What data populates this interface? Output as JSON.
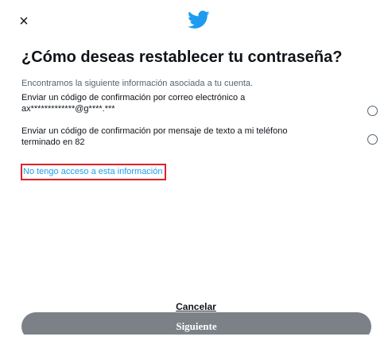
{
  "header": {
    "close_icon": "×",
    "logo_icon": "twitter-bird-icon",
    "brand_color": "#1d9bf0"
  },
  "main": {
    "title": "¿Cómo deseas restablecer tu contraseña?",
    "intro": "Encontramos la siguiente información asociada a tu cuenta.",
    "options": [
      {
        "line1": "Enviar un código de confirmación por correo electrónico a",
        "line2": "ax*************@g****.***",
        "selected": false
      },
      {
        "line1": "Enviar un código de confirmación por mensaje de texto a mi teléfono",
        "line2": "terminado en 82",
        "selected": false
      }
    ],
    "no_access_link": "No tengo acceso a esta información",
    "highlight_color": "#e0202a"
  },
  "footer": {
    "cancel_label": "Cancelar",
    "next_label": "Siguiente",
    "next_button_color": "#7b8187"
  }
}
